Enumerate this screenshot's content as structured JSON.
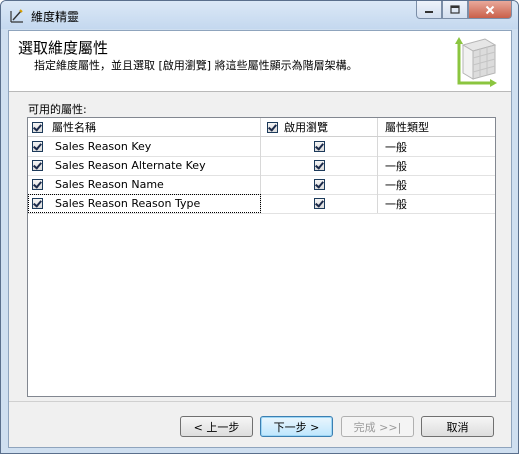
{
  "window": {
    "title": "維度精靈",
    "icon": "wizard-icon",
    "caption_buttons": [
      "minimize-icon",
      "maximize-icon",
      "close-icon"
    ]
  },
  "header": {
    "title": "選取維度屬性",
    "subtitle": "指定維度屬性，並且選取 [啟用瀏覽] 將這些屬性顯示為階層架構。"
  },
  "available_label": "可用的屬性:",
  "grid": {
    "columns": {
      "name": "屬性名稱",
      "browse": "啟用瀏覽",
      "type": "屬性類型"
    },
    "rows": [
      {
        "name": "Sales Reason Key",
        "browse": true,
        "type": "一般",
        "selected": true
      },
      {
        "name": "Sales Reason Alternate Key",
        "browse": true,
        "type": "一般",
        "selected": true
      },
      {
        "name": "Sales Reason Name",
        "browse": true,
        "type": "一般",
        "selected": true
      },
      {
        "name": "Sales Reason Reason Type",
        "browse": true,
        "type": "一般",
        "selected": true
      }
    ]
  },
  "buttons": {
    "back": "< 上一步",
    "next": "下一步 >",
    "finish": "完成 >>|",
    "cancel": "取消"
  }
}
